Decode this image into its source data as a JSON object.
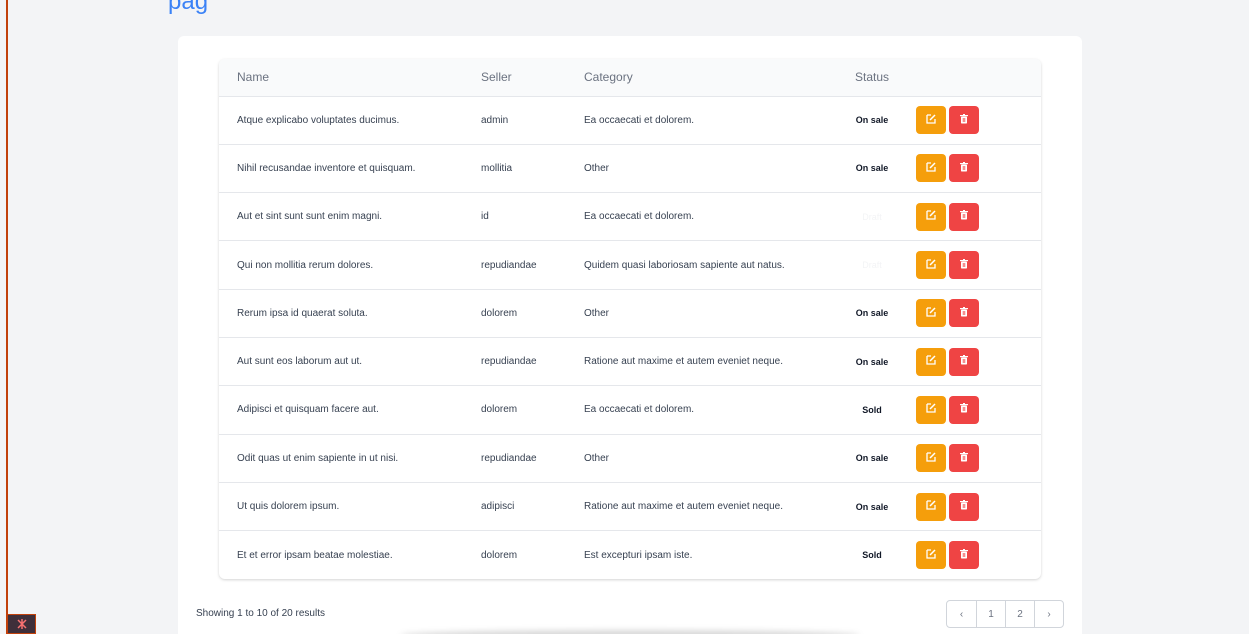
{
  "page": {
    "heading_fragment": "pag"
  },
  "table": {
    "headers": {
      "name": "Name",
      "seller": "Seller",
      "category": "Category",
      "status": "Status"
    },
    "rows": [
      {
        "name": "Atque explicabo voluptates ducimus.",
        "seller": "admin",
        "category": "Ea occaecati et dolorem.",
        "status": "On sale"
      },
      {
        "name": "Nihil recusandae inventore et quisquam.",
        "seller": "mollitia",
        "category": "Other",
        "status": "On sale"
      },
      {
        "name": "Aut et sint sunt sunt enim magni.",
        "seller": "id",
        "category": "Ea occaecati et dolorem.",
        "status": "Draft"
      },
      {
        "name": "Qui non mollitia rerum dolores.",
        "seller": "repudiandae",
        "category": "Quidem quasi laboriosam sapiente aut natus.",
        "status": "Draft"
      },
      {
        "name": "Rerum ipsa id quaerat soluta.",
        "seller": "dolorem",
        "category": "Other",
        "status": "On sale"
      },
      {
        "name": "Aut sunt eos laborum aut ut.",
        "seller": "repudiandae",
        "category": "Ratione aut maxime et autem eveniet neque.",
        "status": "On sale"
      },
      {
        "name": "Adipisci et quisquam facere aut.",
        "seller": "dolorem",
        "category": "Ea occaecati et dolorem.",
        "status": "Sold"
      },
      {
        "name": "Odit quas ut enim sapiente in ut nisi.",
        "seller": "repudiandae",
        "category": "Other",
        "status": "On sale"
      },
      {
        "name": "Ut quis dolorem ipsum.",
        "seller": "adipisci",
        "category": "Ratione aut maxime et autem eveniet neque.",
        "status": "On sale"
      },
      {
        "name": "Et et error ipsam beatae molestiae.",
        "seller": "dolorem",
        "category": "Est excepturi ipsam iste.",
        "status": "Sold"
      }
    ],
    "row_actions": {
      "edit_icon": "edit-icon",
      "delete_icon": "trash-icon"
    }
  },
  "pagination": {
    "summary": "Showing 1 to 10 of 20 results",
    "prev_label": "‹",
    "next_label": "›",
    "pages": [
      "1",
      "2"
    ]
  },
  "colors": {
    "edit": "#f59e0b",
    "delete": "#ef4444",
    "accent": "#3b82f6",
    "rule": "#c2410c"
  }
}
